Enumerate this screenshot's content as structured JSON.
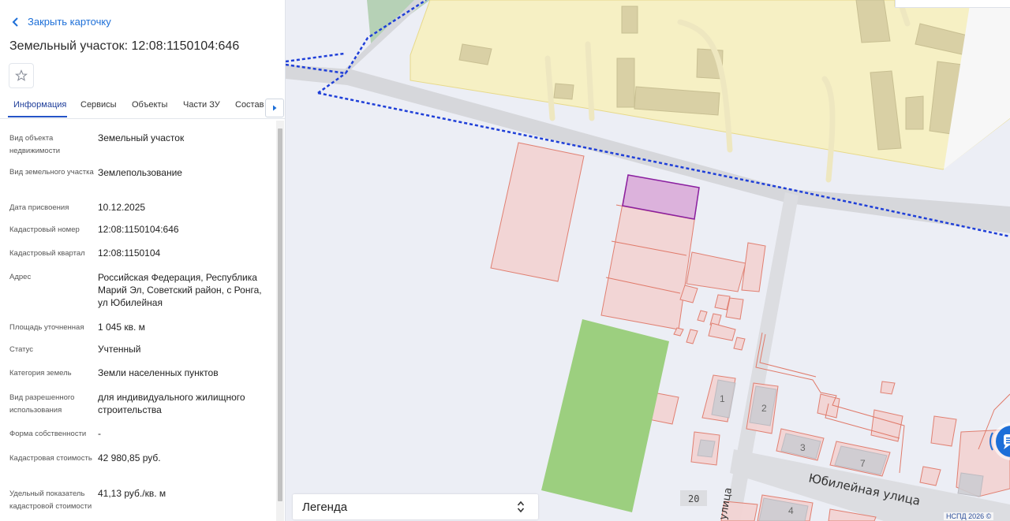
{
  "panel": {
    "back_label": "Закрыть карточку",
    "title": "Земельный участок: 12:08:1150104:646",
    "tabs": [
      "Информация",
      "Сервисы",
      "Объекты",
      "Части ЗУ",
      "Состав"
    ],
    "active_tab": "Информация",
    "rows": [
      {
        "label": "Вид объекта недвижимости",
        "value": "Земельный участок"
      },
      {
        "label": "Вид земельного участка",
        "value": "Землепользование"
      },
      {
        "label": "Дата присвоения",
        "value": "10.12.2025"
      },
      {
        "label": "Кадастровый номер",
        "value": "12:08:1150104:646"
      },
      {
        "label": "Кадастровый квартал",
        "value": "12:08:1150104"
      },
      {
        "label": "Адрес",
        "value": "Российская Федерация, Республика Марий Эл, Советский район, с Ронга, ул Юбилейная"
      },
      {
        "label": "Площадь уточненная",
        "value": "1 045 кв. м"
      },
      {
        "label": "Статус",
        "value": "Учтенный"
      },
      {
        "label": "Категория земель",
        "value": "Земли населенных пунктов"
      },
      {
        "label": "Вид разрешенного использования",
        "value": "для индивидуального жилищного строительства"
      },
      {
        "label": "Форма собственности",
        "value": "-"
      },
      {
        "label": "Кадастровая стоимость",
        "value": "42 980,85 руб."
      },
      {
        "label": "Удельный показатель кадастровой стоимости",
        "value": "41,13 руб./кв. м"
      }
    ]
  },
  "map": {
    "street_name": "Юбилейная улица",
    "street_name_vertical": "улица",
    "house_numbers": [
      "1",
      "2",
      "3",
      "7",
      "4",
      "20"
    ],
    "legend_label": "Легенда",
    "copyright": "НСПД 2026 ©"
  },
  "colors": {
    "selected_parcel_fill": "#dcb2dc",
    "selected_parcel_stroke": "#8a1fa0",
    "parcel_fill": "#f3d4d4",
    "parcel_stroke": "#e07a6a",
    "green_area": "#9ccf7f",
    "yellow_zone": "#f6f0c4",
    "boundary_dashed": "#1f3fd8",
    "accent": "#1d6fd8"
  }
}
